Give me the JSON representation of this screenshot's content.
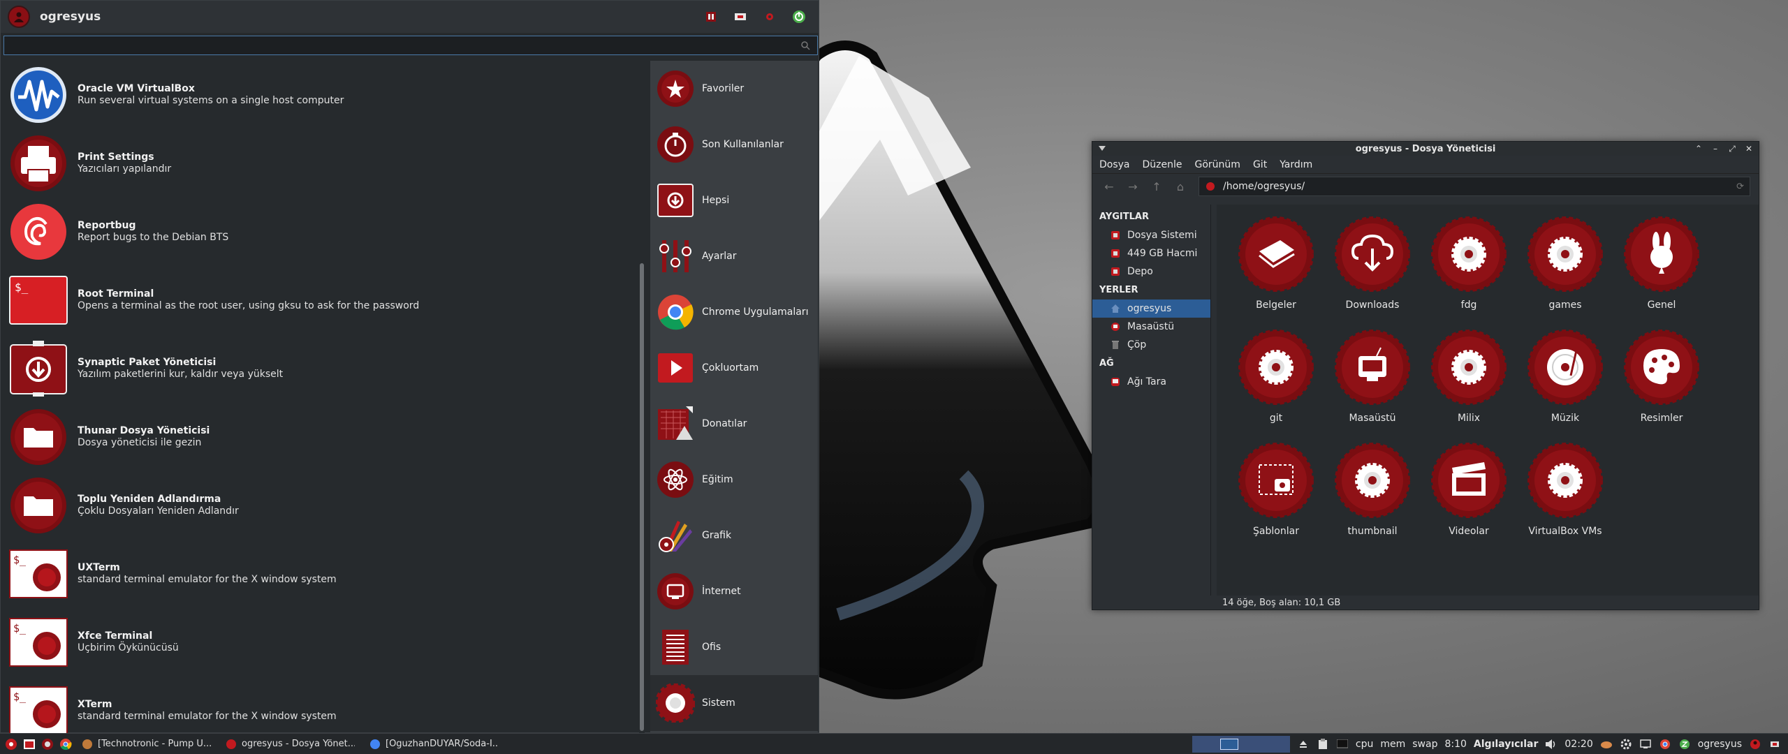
{
  "menu": {
    "username": "ogresyus",
    "search_placeholder": "",
    "apps": [
      {
        "name": "Oracle VM VirtualBox",
        "desc": "Run several virtual systems on a single host computer",
        "icon": "virtualbox-icon"
      },
      {
        "name": "Print Settings",
        "desc": "Yazıcıları yapılandır",
        "icon": "printer-icon"
      },
      {
        "name": "Reportbug",
        "desc": "Report bugs to the Debian BTS",
        "icon": "debian-icon"
      },
      {
        "name": "Root Terminal",
        "desc": "Opens a terminal as the root user, using gksu to ask for the password",
        "icon": "root-terminal-icon"
      },
      {
        "name": "Synaptic Paket Yöneticisi",
        "desc": "Yazılım paketlerini kur, kaldır veya yükselt",
        "icon": "package-manager-icon"
      },
      {
        "name": "Thunar Dosya Yöneticisi",
        "desc": "Dosya yöneticisi ile gezin",
        "icon": "folder-icon"
      },
      {
        "name": "Toplu Yeniden Adlandırma",
        "desc": "Çoklu Dosyaları Yeniden Adlandır",
        "icon": "folder-icon"
      },
      {
        "name": "UXTerm",
        "desc": "standard terminal emulator for the X window system",
        "icon": "terminal-icon"
      },
      {
        "name": "Xfce Terminal",
        "desc": "Uçbirim Öykünücüsü",
        "icon": "terminal-icon"
      },
      {
        "name": "XTerm",
        "desc": "standard terminal emulator for the X window system",
        "icon": "terminal-icon"
      }
    ],
    "categories": [
      {
        "label": "Favoriler",
        "icon": "favorites-icon"
      },
      {
        "label": "Son Kullanılanlar",
        "icon": "recent-icon"
      },
      {
        "label": "Hepsi",
        "icon": "all-apps-icon"
      },
      {
        "label": "Ayarlar",
        "icon": "settings-icon"
      },
      {
        "label": "Chrome Uygulamaları",
        "icon": "chrome-icon"
      },
      {
        "label": "Çokluortam",
        "icon": "multimedia-icon"
      },
      {
        "label": "Donatılar",
        "icon": "accessories-icon"
      },
      {
        "label": "Eğitim",
        "icon": "education-icon"
      },
      {
        "label": "Grafik",
        "icon": "graphics-icon"
      },
      {
        "label": "İnternet",
        "icon": "internet-icon"
      },
      {
        "label": "Ofis",
        "icon": "office-icon"
      },
      {
        "label": "Sistem",
        "icon": "system-icon"
      }
    ],
    "active_category": "Sistem"
  },
  "file_manager": {
    "title": "ogresyus - Dosya Yöneticisi",
    "menubar": [
      "Dosya",
      "Düzenle",
      "Görünüm",
      "Git",
      "Yardım"
    ],
    "location": "/home/ogresyus/",
    "sidebar": [
      {
        "heading": "AYGITLAR",
        "items": [
          {
            "label": "Dosya Sistemi",
            "selected": false
          },
          {
            "label": "449 GB Hacmi",
            "selected": false
          },
          {
            "label": "Depo",
            "selected": false
          }
        ]
      },
      {
        "heading": "YERLER",
        "items": [
          {
            "label": "ogresyus",
            "selected": true
          },
          {
            "label": "Masaüstü",
            "selected": false
          },
          {
            "label": "Çöp",
            "selected": false
          }
        ]
      },
      {
        "heading": "AĞ",
        "items": [
          {
            "label": "Ağı Tara",
            "selected": false
          }
        ]
      }
    ],
    "files": [
      {
        "name": "Belgeler",
        "icon": "documents-folder-icon"
      },
      {
        "name": "Downloads",
        "icon": "downloads-folder-icon"
      },
      {
        "name": "fdg",
        "icon": "folder-icon"
      },
      {
        "name": "games",
        "icon": "folder-icon"
      },
      {
        "name": "Genel",
        "icon": "public-folder-icon"
      },
      {
        "name": "git",
        "icon": "folder-icon"
      },
      {
        "name": "Masaüstü",
        "icon": "desktop-folder-icon"
      },
      {
        "name": "Milix",
        "icon": "folder-icon"
      },
      {
        "name": "Müzik",
        "icon": "music-folder-icon"
      },
      {
        "name": "Resimler",
        "icon": "pictures-folder-icon"
      },
      {
        "name": "Şablonlar",
        "icon": "templates-folder-icon"
      },
      {
        "name": "thumbnail",
        "icon": "folder-icon"
      },
      {
        "name": "Videolar",
        "icon": "videos-folder-icon"
      },
      {
        "name": "VirtualBox VMs",
        "icon": "folder-icon"
      }
    ],
    "status": "14 öğe, Boş alan: 10,1 GB"
  },
  "taskbar": {
    "tasks": [
      {
        "label": "[Technotronic - Pump U...",
        "color": "#c07a3a"
      },
      {
        "label": "ogresyus - Dosya Yönet...",
        "color": "#c21a1f"
      },
      {
        "label": "[OguzhanDUYAR/Soda-I...",
        "color": "#4285f4"
      }
    ],
    "monitors": [
      "cpu",
      "mem",
      "swap"
    ],
    "time_short": "8:10",
    "sensors": "Algılayıcılar",
    "clock": "02:20",
    "user": "ogresyus"
  },
  "colors": {
    "accent": "#c21a1f",
    "selection": "#2c5d96",
    "panel": "#262a2d"
  }
}
